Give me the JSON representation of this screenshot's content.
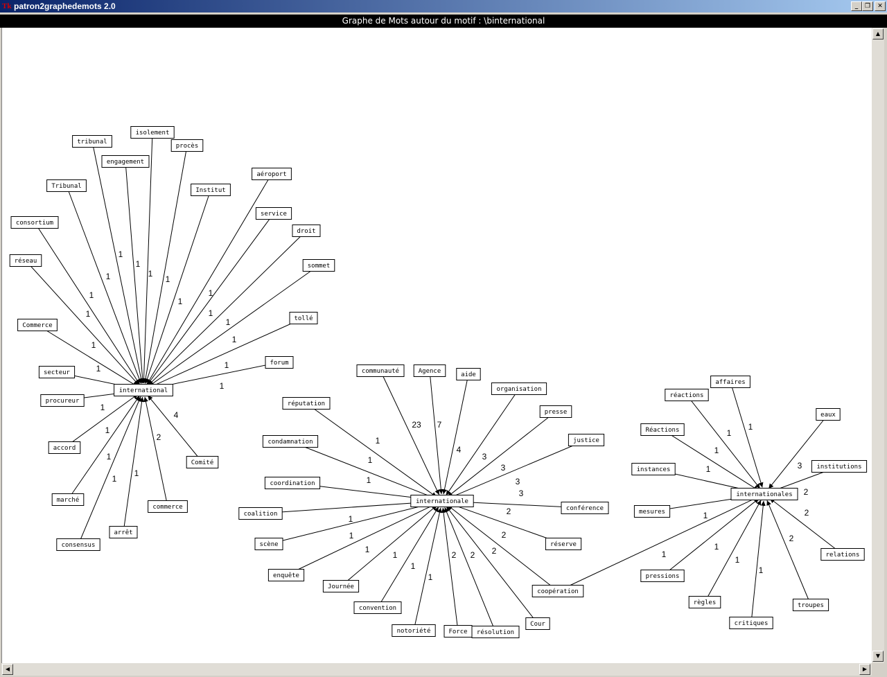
{
  "window": {
    "title": "patron2graphedemots 2.0",
    "app_icon": "Tk"
  },
  "header": {
    "title": "Graphe de Mots autour du motif : \\binternational"
  },
  "graph": {
    "centers": [
      {
        "id": "c1",
        "label": "international"
      },
      {
        "id": "c2",
        "label": "internationale"
      },
      {
        "id": "c3",
        "label": "internationales"
      }
    ],
    "edges": [
      {
        "target": "c1",
        "label": "tribunal",
        "weight": "1"
      },
      {
        "target": "c1",
        "label": "isolement",
        "weight": "1"
      },
      {
        "target": "c1",
        "label": "procès",
        "weight": "1"
      },
      {
        "target": "c1",
        "label": "engagement",
        "weight": "1"
      },
      {
        "target": "c1",
        "label": "Tribunal",
        "weight": "1"
      },
      {
        "target": "c1",
        "label": "Institut",
        "weight": "1"
      },
      {
        "target": "c1",
        "label": "aéroport",
        "weight": "1"
      },
      {
        "target": "c1",
        "label": "consortium",
        "weight": "1"
      },
      {
        "target": "c1",
        "label": "service",
        "weight": "1"
      },
      {
        "target": "c1",
        "label": "droit",
        "weight": "1"
      },
      {
        "target": "c1",
        "label": "réseau",
        "weight": "1"
      },
      {
        "target": "c1",
        "label": "sommet",
        "weight": "1"
      },
      {
        "target": "c1",
        "label": "tollé",
        "weight": "1"
      },
      {
        "target": "c1",
        "label": "Commerce",
        "weight": "1"
      },
      {
        "target": "c1",
        "label": "forum",
        "weight": "1"
      },
      {
        "target": "c1",
        "label": "secteur",
        "weight": "1"
      },
      {
        "target": "c1",
        "label": "procureur",
        "weight": "1"
      },
      {
        "target": "c1",
        "label": "accord",
        "weight": "1"
      },
      {
        "target": "c1",
        "label": "marché",
        "weight": "1"
      },
      {
        "target": "c1",
        "label": "consensus",
        "weight": "1"
      },
      {
        "target": "c1",
        "label": "arrêt",
        "weight": "1"
      },
      {
        "target": "c1",
        "label": "commerce",
        "weight": "2"
      },
      {
        "target": "c1",
        "label": "Comité",
        "weight": "4"
      },
      {
        "target": "c2",
        "label": "communauté",
        "weight": "23"
      },
      {
        "target": "c2",
        "label": "Agence",
        "weight": "7"
      },
      {
        "target": "c2",
        "label": "aide",
        "weight": "4"
      },
      {
        "target": "c2",
        "label": "organisation",
        "weight": "3"
      },
      {
        "target": "c2",
        "label": "presse",
        "weight": "3"
      },
      {
        "target": "c2",
        "label": "justice",
        "weight": "3"
      },
      {
        "target": "c2",
        "label": "réputation",
        "weight": "1"
      },
      {
        "target": "c2",
        "label": "condamnation",
        "weight": "1"
      },
      {
        "target": "c2",
        "label": "coordination",
        "weight": "1"
      },
      {
        "target": "c2",
        "label": "conférence",
        "weight": "3"
      },
      {
        "target": "c2",
        "label": "coalition",
        "weight": "1"
      },
      {
        "target": "c2",
        "label": "scène",
        "weight": "1"
      },
      {
        "target": "c2",
        "label": "réserve",
        "weight": "2"
      },
      {
        "target": "c2",
        "label": "enquête",
        "weight": "1"
      },
      {
        "target": "c2",
        "label": "Journée",
        "weight": "1"
      },
      {
        "target": "c2",
        "label": "convention",
        "weight": "1"
      },
      {
        "target": "c2",
        "label": "notoriété",
        "weight": "1"
      },
      {
        "target": "c2",
        "label": "Force",
        "weight": "2"
      },
      {
        "target": "c2",
        "label": "résolution",
        "weight": "2"
      },
      {
        "target": "c2",
        "label": "Cour",
        "weight": "2"
      },
      {
        "target": "c2",
        "label": "coopération",
        "weight": "2"
      },
      {
        "target": "c3",
        "label": "réactions",
        "weight": "1"
      },
      {
        "target": "c3",
        "label": "affaires",
        "weight": "1"
      },
      {
        "target": "c3",
        "label": "eaux",
        "weight": "3"
      },
      {
        "target": "c3",
        "label": "Réactions",
        "weight": "1"
      },
      {
        "target": "c3",
        "label": "institutions",
        "weight": "2"
      },
      {
        "target": "c3",
        "label": "instances",
        "weight": "1"
      },
      {
        "target": "c3",
        "label": "mesures",
        "weight": "1"
      },
      {
        "target": "c3",
        "label": "relations",
        "weight": "2"
      },
      {
        "target": "c3",
        "label": "coopération",
        "weight": "1"
      },
      {
        "target": "c3",
        "label": "pressions",
        "weight": "1"
      },
      {
        "target": "c3",
        "label": "règles",
        "weight": "1"
      },
      {
        "target": "c3",
        "label": "critiques",
        "weight": "1"
      },
      {
        "target": "c3",
        "label": "troupes",
        "weight": "2"
      }
    ]
  }
}
